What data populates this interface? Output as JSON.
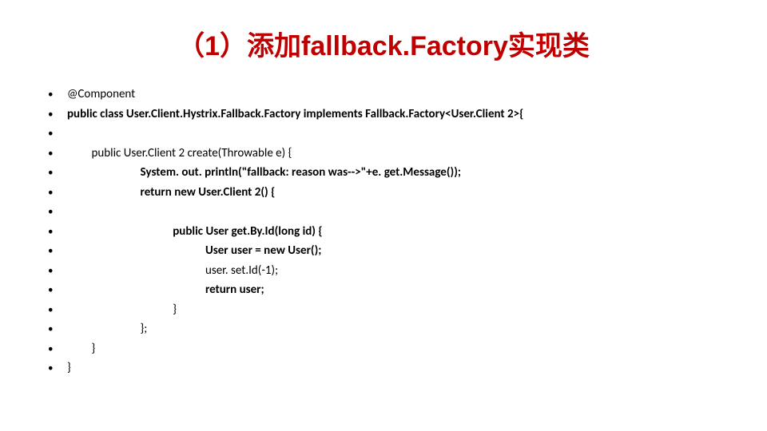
{
  "title": "（1）添加fallback.Factory实现类",
  "lines": [
    {
      "text": "@Component",
      "weight": "normal"
    },
    {
      "text": "public class User.Client.Hystrix.Fallback.Factory implements Fallback.Factory<User.Client 2>{",
      "weight": "bold"
    },
    {
      "text": " ",
      "weight": "normal"
    },
    {
      "text": "         public User.Client 2 create(Throwable e) {",
      "weight": "normal"
    },
    {
      "text": "                           System. out. println(\"fallback: reason was-->\"+e. get.Message());",
      "weight": "bold"
    },
    {
      "text": "                           return new User.Client 2() {",
      "weight": "bold"
    },
    {
      "text": " ",
      "weight": "normal"
    },
    {
      "text": "                                       public User get.By.Id(long id) {",
      "weight": "bold"
    },
    {
      "text": "                                                   User user = new User();",
      "weight": "bold"
    },
    {
      "text": "                                                   user. set.Id(-1);",
      "weight": "normal"
    },
    {
      "text": "                                                   return user;",
      "weight": "bold"
    },
    {
      "text": "                                       }",
      "weight": "normal"
    },
    {
      "text": "                           };",
      "weight": "normal"
    },
    {
      "text": "         }",
      "weight": "normal"
    },
    {
      "text": "}",
      "weight": "normal"
    }
  ]
}
